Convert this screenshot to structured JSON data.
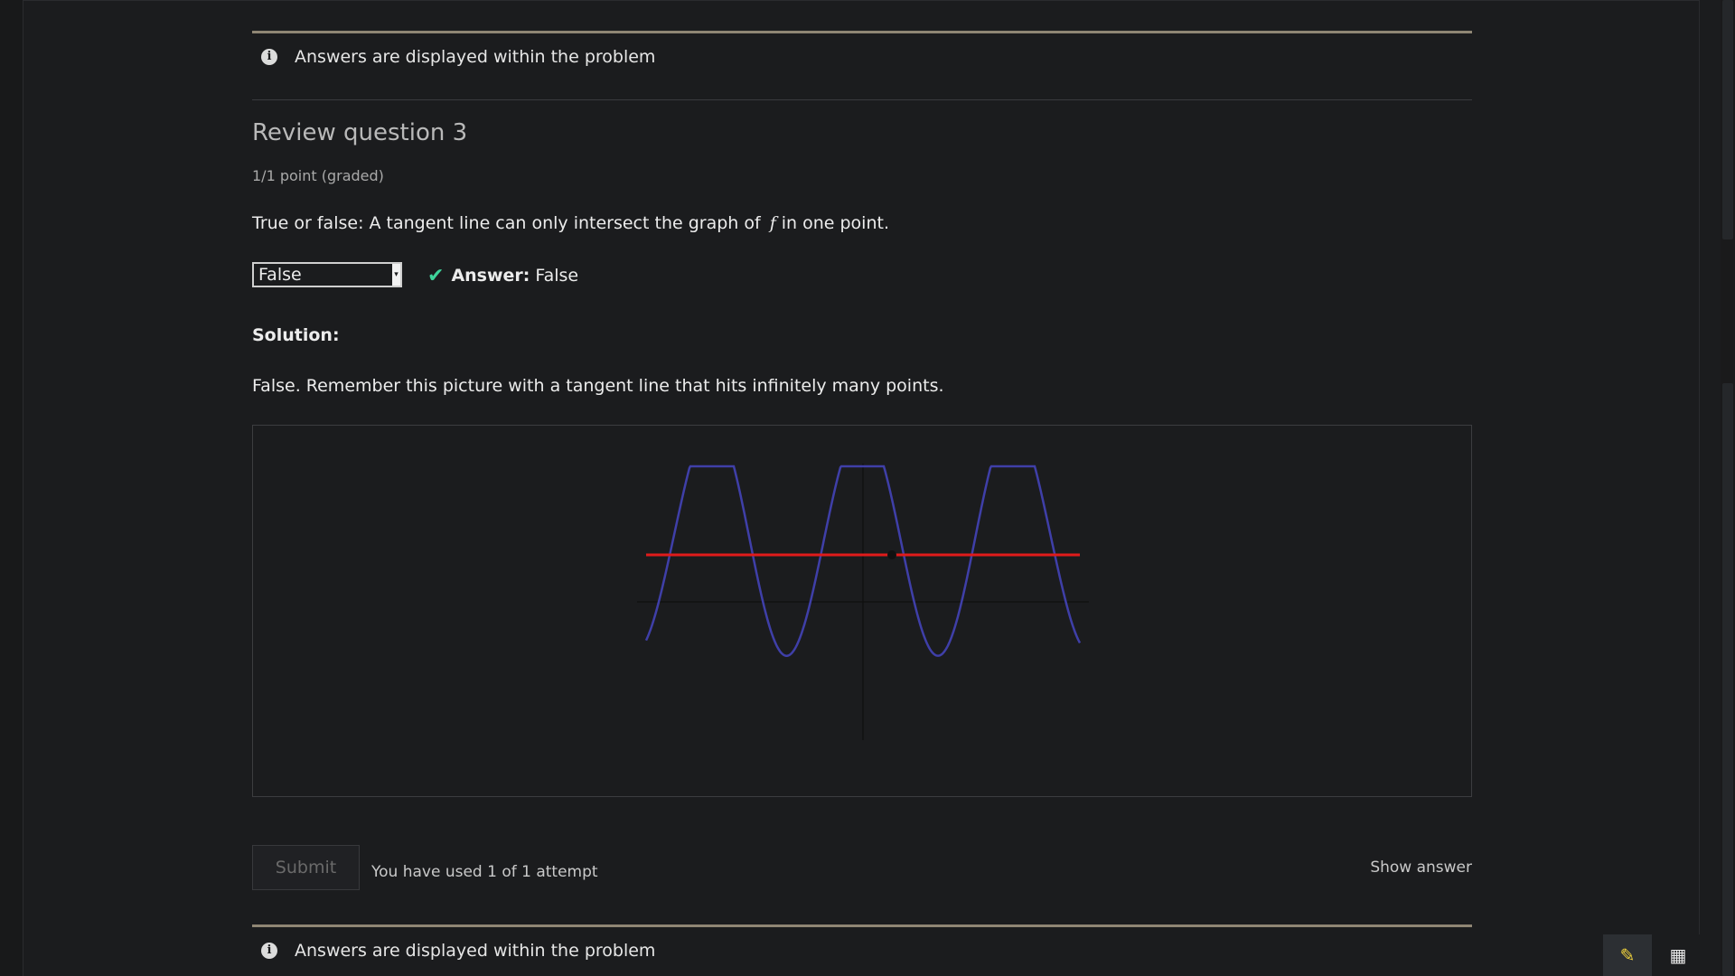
{
  "notices": {
    "top": "Answers are displayed within the problem",
    "bottom": "Answers are displayed within the problem"
  },
  "question": {
    "title": "Review question 3",
    "points": "1/1 point (graded)",
    "prompt_before": "True or false: A tangent line can only intersect the graph of",
    "prompt_var": "f",
    "prompt_after": "in one point.",
    "selected_value": "False",
    "answer_label": "Answer:",
    "answer_value": "False"
  },
  "solution": {
    "heading": "Solution:",
    "text": "False. Remember this picture with a tangent line that hits infinitely many points."
  },
  "graph": {
    "curve_color": "#3f3fa8",
    "tangent_color": "#e01b1b",
    "axis_color": "#111111"
  },
  "actions": {
    "submit_label": "Submit",
    "attempts_text": "You have used 1 of 1 attempt",
    "show_answer_label": "Show answer"
  },
  "toolbar": {
    "pencil_icon": "pencil-icon",
    "calculator_icon": "calculator-icon"
  },
  "colors": {
    "background": "#1b1c1e",
    "rule_accent": "#8f8674",
    "check_green": "#3ed39a"
  }
}
